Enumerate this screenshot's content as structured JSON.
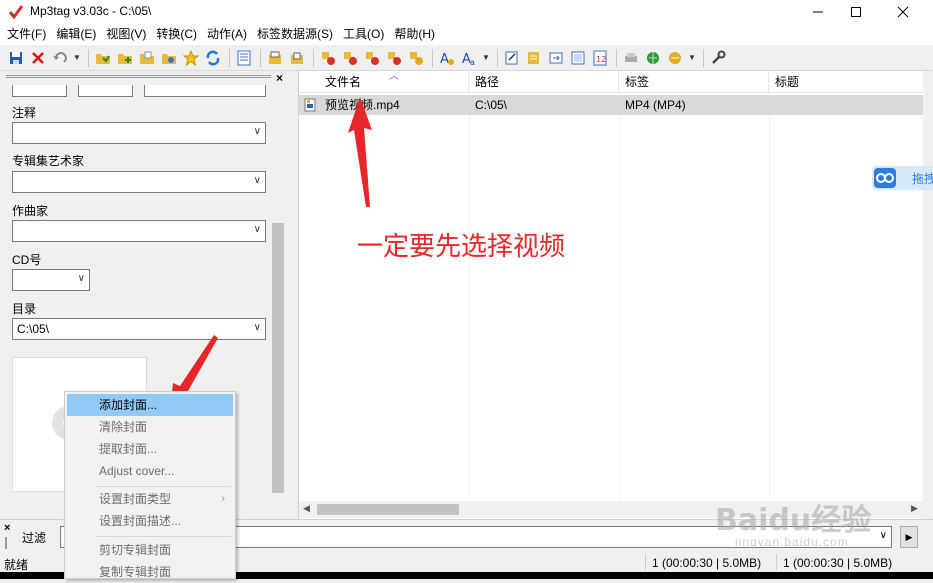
{
  "window": {
    "title": "Mp3tag v3.03c  -  C:\\05\\",
    "minimize_icon": "minimize-icon",
    "maximize_icon": "maximize-icon",
    "close_icon": "close-icon"
  },
  "menu": [
    "文件(F)",
    "编辑(E)",
    "视图(V)",
    "转换(C)",
    "动作(A)",
    "标签数据源(S)",
    "工具(O)",
    "帮助(H)"
  ],
  "left_panel": {
    "fields": [
      {
        "label": "注释",
        "value": ""
      },
      {
        "label": "专辑集艺术家",
        "value": ""
      },
      {
        "label": "作曲家",
        "value": ""
      },
      {
        "label": "CD号",
        "value": ""
      },
      {
        "label": "目录",
        "value": "C:\\05\\"
      }
    ]
  },
  "file_list": {
    "columns": [
      "文件名",
      "路径",
      "标签",
      "标题"
    ],
    "rows": [
      {
        "filename": "预览视频.mp4",
        "path": "C:\\05\\",
        "tag": "MP4 (MP4)",
        "title": ""
      }
    ]
  },
  "context_menu": {
    "items": [
      {
        "label": "添加封面...",
        "active": true
      },
      {
        "label": "清除封面"
      },
      {
        "label": "提取封面..."
      },
      {
        "label": "Adjust cover..."
      },
      {
        "label": "设置封面类型",
        "submenu": "›"
      },
      {
        "label": "设置封面描述..."
      },
      {
        "label": "剪切专辑封面"
      },
      {
        "label": "复制专辑封面"
      }
    ]
  },
  "filter": {
    "label": "过滤",
    "value": "",
    "go": "▶"
  },
  "status": {
    "left": "就绪",
    "selected": "1 (00:00:30 | 5.0MB)",
    "total": "1 (00:00:30 | 5.0MB)"
  },
  "annotation": {
    "text": "一定要先选择视频",
    "color": "#e8262a"
  },
  "baidu_widget": {
    "text": "拖拽"
  },
  "watermark": {
    "main": "Baidu经验",
    "sub": "jingyan.baidu.com"
  }
}
